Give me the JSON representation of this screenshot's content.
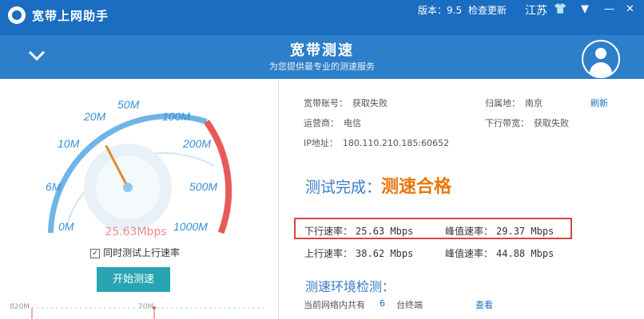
{
  "titlebar": {
    "app_name": "宽带上网助手",
    "version": "版本：9.5",
    "check_update": "检查更新",
    "location": "江苏",
    "icons": [
      "shirt-icon",
      "menu-icon",
      "minimize-icon",
      "close-icon"
    ]
  },
  "banner": {
    "title": "宽带测速",
    "subtitle": "为您提供最专业的测速服务"
  },
  "gauge": {
    "ticks": [
      "0M",
      "6M",
      "10M",
      "20M",
      "50M",
      "100M",
      "200M",
      "500M",
      "1000M"
    ],
    "reading": "25.63Mbps",
    "needle_value_mbps": 25.63
  },
  "left": {
    "checkbox_label": "同时测试上行速率",
    "checkbox_checked": true,
    "start_button": "开始测速",
    "mini_labels": [
      "820M",
      "70M"
    ]
  },
  "info": {
    "account_label": "宽带账号：",
    "account_value": "获取失败",
    "region_label": "归属地：",
    "region_value": "南京",
    "refresh": "刷新",
    "isp_label": "运营商：",
    "isp_value": "电信",
    "bandwidth_label": "下行带宽：",
    "bandwidth_value": "获取失败",
    "ip_label": "IP地址：",
    "ip_value": "180.110.210.185:60652"
  },
  "result": {
    "prefix": "测试完成：",
    "status": "测速合格"
  },
  "speeds": {
    "down_label": "下行速率：",
    "down_value": "25.63 Mbps",
    "down_peak_label": "峰值速率：",
    "down_peak_value": "29.37 Mbps",
    "up_label": "上行速率：",
    "up_value": "38.62 Mbps",
    "up_peak_label": "峰值速率：",
    "up_peak_value": "44.88 Mbps"
  },
  "env": {
    "title": "测速环境检测：",
    "line1_prefix": "当前网络内共有",
    "line1_count": "6",
    "line1_suffix": "台终端",
    "line1_link": "查看"
  },
  "colors": {
    "titlebar": "#1a6dc0",
    "banner": "#2d7fc9",
    "accent_blue": "#3a7bc8",
    "result_orange": "#e8770b",
    "highlight_red": "#d64545",
    "start_button": "#27a5b3"
  }
}
